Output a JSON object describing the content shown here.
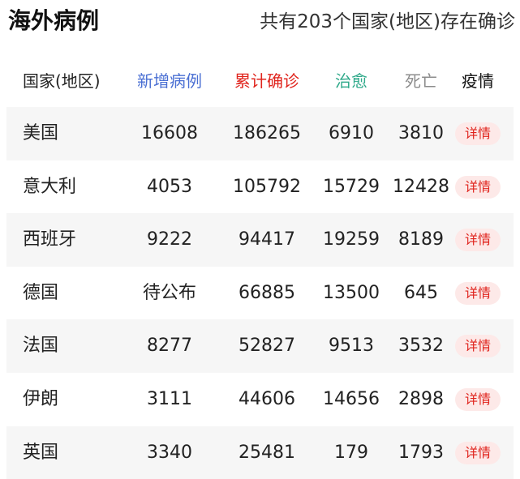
{
  "page": {
    "title": "海外病例",
    "summary": "共有203个国家(地区)存在确诊"
  },
  "columns": {
    "country": "国家(地区)",
    "new_cases": "新增病例",
    "total_cases": "累计确诊",
    "cured": "治愈",
    "deaths": "死亡",
    "detail": "疫情"
  },
  "colors": {
    "new_cases": "#4a6fd3",
    "total_cases": "#e0241d",
    "cured": "#2fa98a",
    "deaths": "#8c8c8c",
    "detail_button_bg": "#fde9e8",
    "detail_button_text": "#e0241d",
    "row_stripe": "#f6f6f6"
  },
  "rows": [
    {
      "country": "美国",
      "new_cases": "16608",
      "total_cases": "186265",
      "cured": "6910",
      "deaths": "3810",
      "detail_label": "详情"
    },
    {
      "country": "意大利",
      "new_cases": "4053",
      "total_cases": "105792",
      "cured": "15729",
      "deaths": "12428",
      "detail_label": "详情"
    },
    {
      "country": "西班牙",
      "new_cases": "9222",
      "total_cases": "94417",
      "cured": "19259",
      "deaths": "8189",
      "detail_label": "详情"
    },
    {
      "country": "德国",
      "new_cases": "待公布",
      "total_cases": "66885",
      "cured": "13500",
      "deaths": "645",
      "detail_label": "详情"
    },
    {
      "country": "法国",
      "new_cases": "8277",
      "total_cases": "52827",
      "cured": "9513",
      "deaths": "3532",
      "detail_label": "详情"
    },
    {
      "country": "伊朗",
      "new_cases": "3111",
      "total_cases": "44606",
      "cured": "14656",
      "deaths": "2898",
      "detail_label": "详情"
    },
    {
      "country": "英国",
      "new_cases": "3340",
      "total_cases": "25481",
      "cured": "179",
      "deaths": "1793",
      "detail_label": "详情"
    }
  ]
}
